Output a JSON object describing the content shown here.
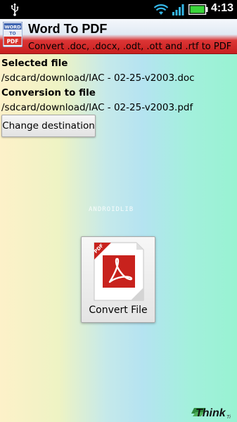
{
  "status_bar": {
    "time": "4:13",
    "icons": [
      "usb-icon",
      "wifi-icon",
      "signal-icon",
      "battery-icon"
    ],
    "battery_color": "#3ad63a"
  },
  "app": {
    "title": "Word To PDF",
    "subtitle": "Convert .doc, .docx, .odt, .ott and .rtf to PDF",
    "icon_text_top": "WORD",
    "icon_text_mid": "TO",
    "icon_text_bottom": "PDF",
    "titlebar_accent": "#dc3535"
  },
  "selected_file": {
    "label": "Selected file",
    "path": "/sdcard/download/IAC - 02-25-v2003.doc"
  },
  "conversion": {
    "label": "Conversion to file",
    "path": "/sdcard/download/IAC - 02-25-v2003.pdf"
  },
  "buttons": {
    "change_destination": "Change destination",
    "convert_file": "Convert File"
  },
  "pdf_badge": "PDF",
  "watermark": "ANDROIDLIB",
  "brand": {
    "name": "Think",
    "suffix": "Ti"
  }
}
